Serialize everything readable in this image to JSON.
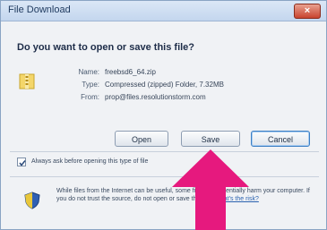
{
  "dialog": {
    "title": "File Download",
    "close_label": "×",
    "question": "Do you want to open or save this file?",
    "file_icon": "zip-folder-icon",
    "details": [
      {
        "label": "Name:",
        "value": "freebsd6_64.zip"
      },
      {
        "label": "Type:",
        "value": "Compressed (zipped) Folder, 7.32MB"
      },
      {
        "label": "From:",
        "value": "prop@files.resolutionstorm.com"
      }
    ],
    "buttons": {
      "open": "Open",
      "save": "Save",
      "cancel": "Cancel"
    },
    "checkbox_label": "Always ask before opening this type of file",
    "checkbox_checked": true,
    "warning_text": "While files from the Internet can be useful, some files can potentially harm your computer. If you do not trust the source, do not open or save this file.",
    "warning_link": "What's the risk?",
    "shield_icon": "security-shield-icon"
  },
  "overlay": {
    "icon": "up-arrow-icon",
    "color": "#e6197e"
  }
}
